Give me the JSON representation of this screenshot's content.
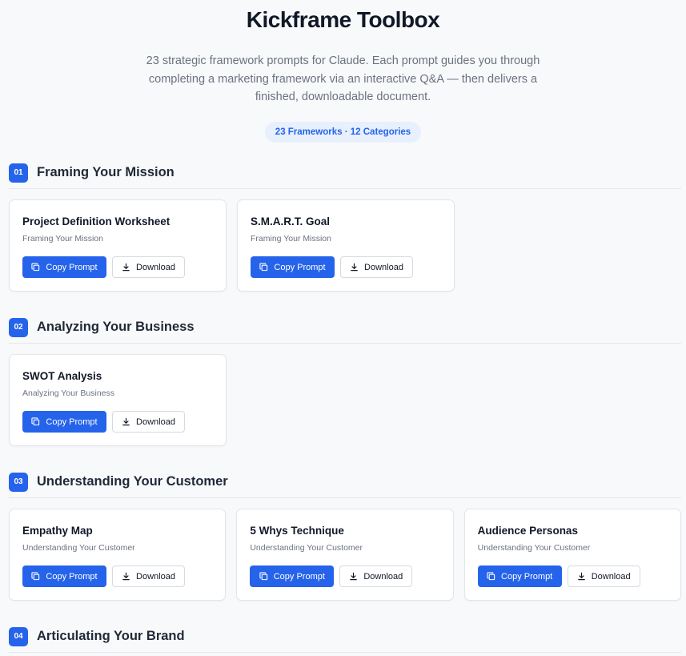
{
  "header": {
    "title": "Kickframe Toolbox",
    "subtitle": "23 strategic framework prompts for Claude. Each prompt guides you through completing a marketing framework via an interactive Q&A — then delivers a finished, downloadable document.",
    "pill": "23 Frameworks · 12 Categories"
  },
  "buttons": {
    "copy_label": "Copy Prompt",
    "download_label": "Download"
  },
  "colors": {
    "accent": "#2563eb",
    "pill_bg": "#e8f0fd",
    "page_bg": "#f8f9fb"
  },
  "icons": {
    "copy": "copy-icon",
    "download": "download-icon"
  },
  "sections": [
    {
      "number": "01",
      "title": "Framing Your Mission",
      "cards": [
        {
          "title": "Project Definition Worksheet",
          "category": "Framing Your Mission"
        },
        {
          "title": "S.M.A.R.T. Goal",
          "category": "Framing Your Mission"
        }
      ]
    },
    {
      "number": "02",
      "title": "Analyzing Your Business",
      "cards": [
        {
          "title": "SWOT Analysis",
          "category": "Analyzing Your Business"
        }
      ]
    },
    {
      "number": "03",
      "title": "Understanding Your Customer",
      "cards": [
        {
          "title": "Empathy Map",
          "category": "Understanding Your Customer"
        },
        {
          "title": "5 Whys Technique",
          "category": "Understanding Your Customer"
        },
        {
          "title": "Audience Personas",
          "category": "Understanding Your Customer"
        }
      ]
    },
    {
      "number": "04",
      "title": "Articulating Your Brand",
      "cards": []
    }
  ]
}
